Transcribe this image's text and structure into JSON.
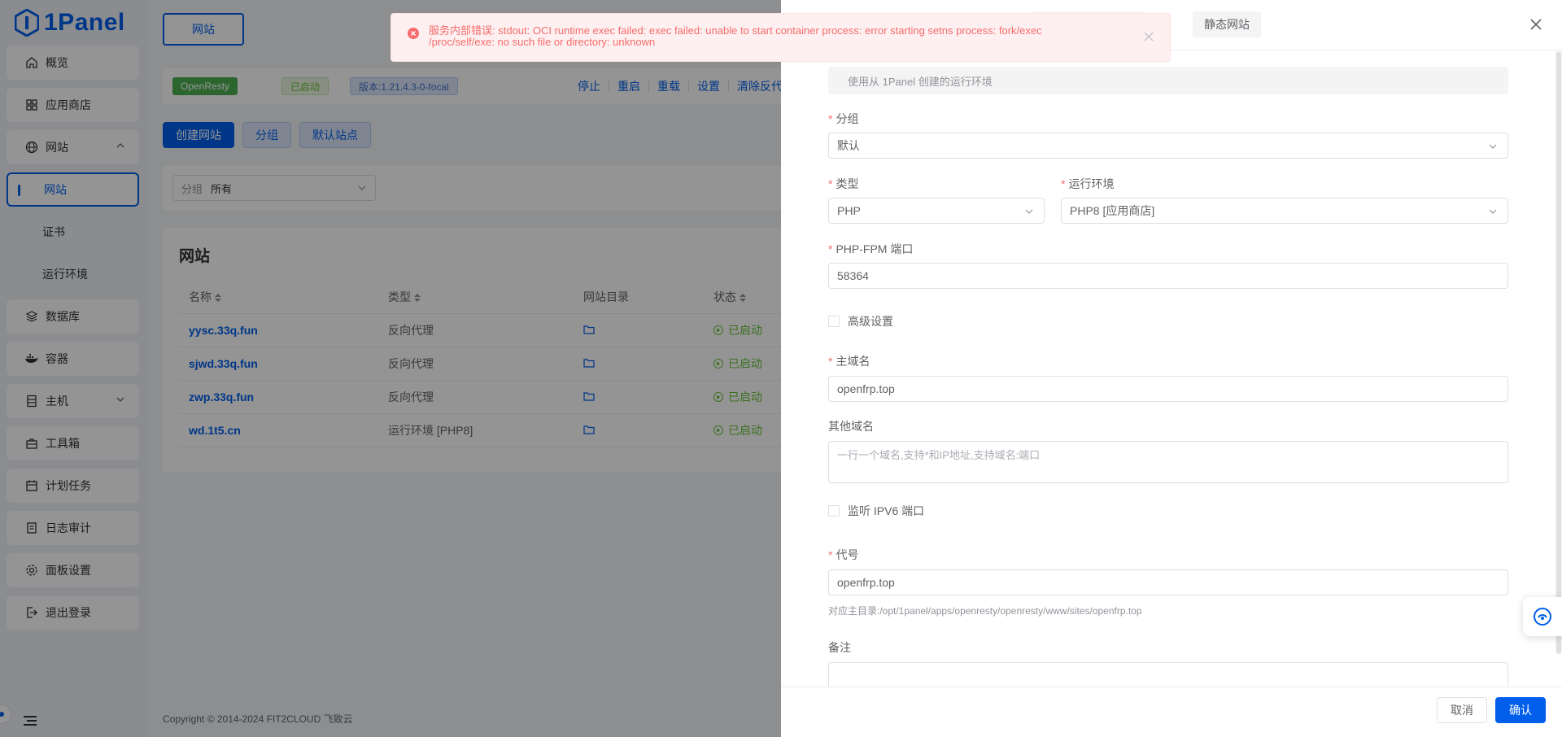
{
  "app": {
    "logo_text": "1Panel",
    "brand_color": "#005eeb"
  },
  "sidebar": {
    "items": [
      {
        "label": "概览",
        "icon": "home-icon"
      },
      {
        "label": "应用商店",
        "icon": "grid-icon"
      },
      {
        "label": "网站",
        "icon": "globe-icon",
        "expanded": true
      },
      {
        "label": "网站",
        "sub": true,
        "active": true
      },
      {
        "label": "证书",
        "sub": true
      },
      {
        "label": "运行环境",
        "sub": true
      },
      {
        "label": "数据库",
        "icon": "layers-icon"
      },
      {
        "label": "容器",
        "icon": "docker-icon"
      },
      {
        "label": "主机",
        "icon": "server-icon"
      },
      {
        "label": "工具箱",
        "icon": "toolbox-icon"
      },
      {
        "label": "计划任务",
        "icon": "calendar-icon"
      },
      {
        "label": "日志审计",
        "icon": "log-icon"
      },
      {
        "label": "面板设置",
        "icon": "gear-icon"
      },
      {
        "label": "退出登录",
        "icon": "logout-icon"
      }
    ]
  },
  "topbar": {
    "tab_label": "网站"
  },
  "appbar": {
    "app_name": "OpenResty",
    "status": "已启动",
    "version": "版本:1.21.4.3-0-focal",
    "actions": [
      "停止",
      "重启",
      "重载",
      "设置",
      "清除反代缓"
    ]
  },
  "buttons": {
    "create": "创建网站",
    "group": "分组",
    "default_site": "默认站点"
  },
  "filter": {
    "label": "分组",
    "value": "所有"
  },
  "sites_card": {
    "title": "网站",
    "columns": [
      "名称",
      "类型",
      "网站目录",
      "状态"
    ],
    "rows": [
      {
        "name": "yysc.33q.fun",
        "type": "反向代理",
        "status": "已启动"
      },
      {
        "name": "sjwd.33q.fun",
        "type": "反向代理",
        "status": "已启动"
      },
      {
        "name": "zwp.33q.fun",
        "type": "反向代理",
        "status": "已启动"
      },
      {
        "name": "wd.1t5.cn",
        "type": "运行环境 [PHP8]",
        "status": "已启动"
      }
    ]
  },
  "footer": {
    "copyright": "Copyright © 2014-2024 FIT2CLOUD 飞致云"
  },
  "toast": {
    "message": "服务内部错误: stdout: OCI runtime exec failed: exec failed: unable to start container process: error starting setns process: fork/exec /proc/self/exe: no such file or directory: unknown",
    "color": "#f56c6c"
  },
  "drawer": {
    "tab_static": "静态网站",
    "hint": "使用从 1Panel 创建的运行环境",
    "group": {
      "label": "分组",
      "value": "默认"
    },
    "type": {
      "label": "类型",
      "value": "PHP"
    },
    "runtime": {
      "label": "运行环境",
      "value": "PHP8 [应用商店]"
    },
    "fpm_port": {
      "label": "PHP-FPM 端口",
      "value": "58364"
    },
    "advanced": {
      "label": "高级设置"
    },
    "primary_domain": {
      "label": "主域名",
      "value": "openfrp.top"
    },
    "other_domains": {
      "label": "其他域名",
      "placeholder": "一行一个域名,支持*和IP地址,支持域名:端口"
    },
    "ipv6": {
      "label": "监听 IPV6 端口"
    },
    "alias": {
      "label": "代号",
      "value": "openfrp.top",
      "help": "对应主目录:/opt/1panel/apps/openresty/openresty/www/sites/openfrp.top"
    },
    "remark": {
      "label": "备注"
    },
    "cancel": "取消",
    "confirm": "确认"
  }
}
